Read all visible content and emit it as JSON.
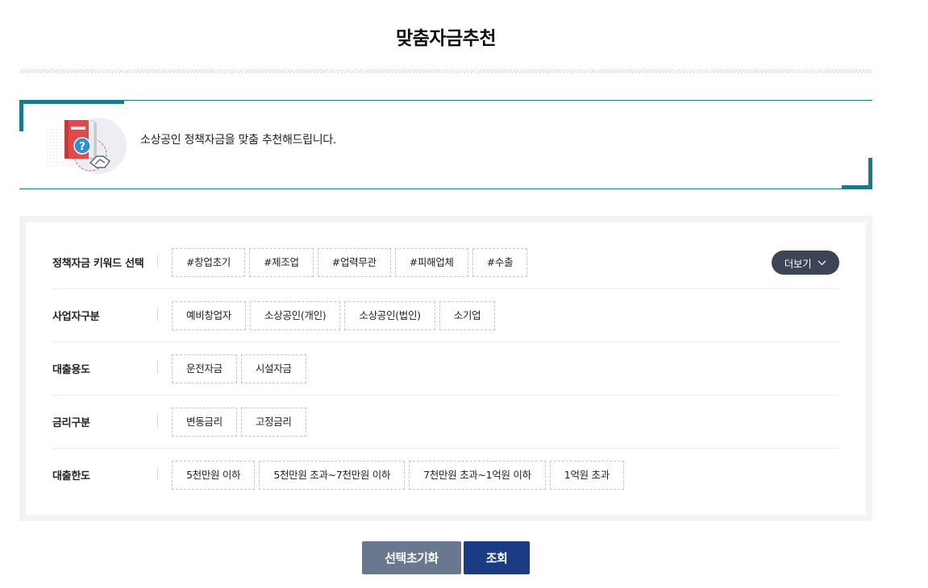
{
  "header": {
    "title": "맞춤자금추천"
  },
  "intro": {
    "icon": "policy-book-handshake-icon",
    "text": "소상공인 정책자금을 맞춤 추천해드립니다."
  },
  "filters": [
    {
      "label": "정책자금 키워드 선택",
      "options": [
        "#창업초기",
        "#제조업",
        "#업력무관",
        "#피해업체",
        "#수출"
      ]
    },
    {
      "label": "사업자구분",
      "options": [
        "예비창업자",
        "소상공인(개인)",
        "소상공인(법인)",
        "소기업"
      ]
    },
    {
      "label": "대출용도",
      "options": [
        "운전자금",
        "시설자금"
      ]
    },
    {
      "label": "금리구분",
      "options": [
        "변동금리",
        "고정금리"
      ]
    },
    {
      "label": "대출한도",
      "options": [
        "5천만원 이하",
        "5천만원 초과~7천만원 이하",
        "7천만원 초과~1억원 이하",
        "1억원 초과"
      ]
    }
  ],
  "more": {
    "label": "더보기",
    "icon": "chevron-down-icon"
  },
  "actions": {
    "reset_label": "선택초기화",
    "search_label": "조회"
  },
  "colors": {
    "accent_teal": "#1a7a88",
    "more_button": "#3d4457",
    "reset_button": "#6a788f",
    "search_button": "#1b3c84"
  }
}
